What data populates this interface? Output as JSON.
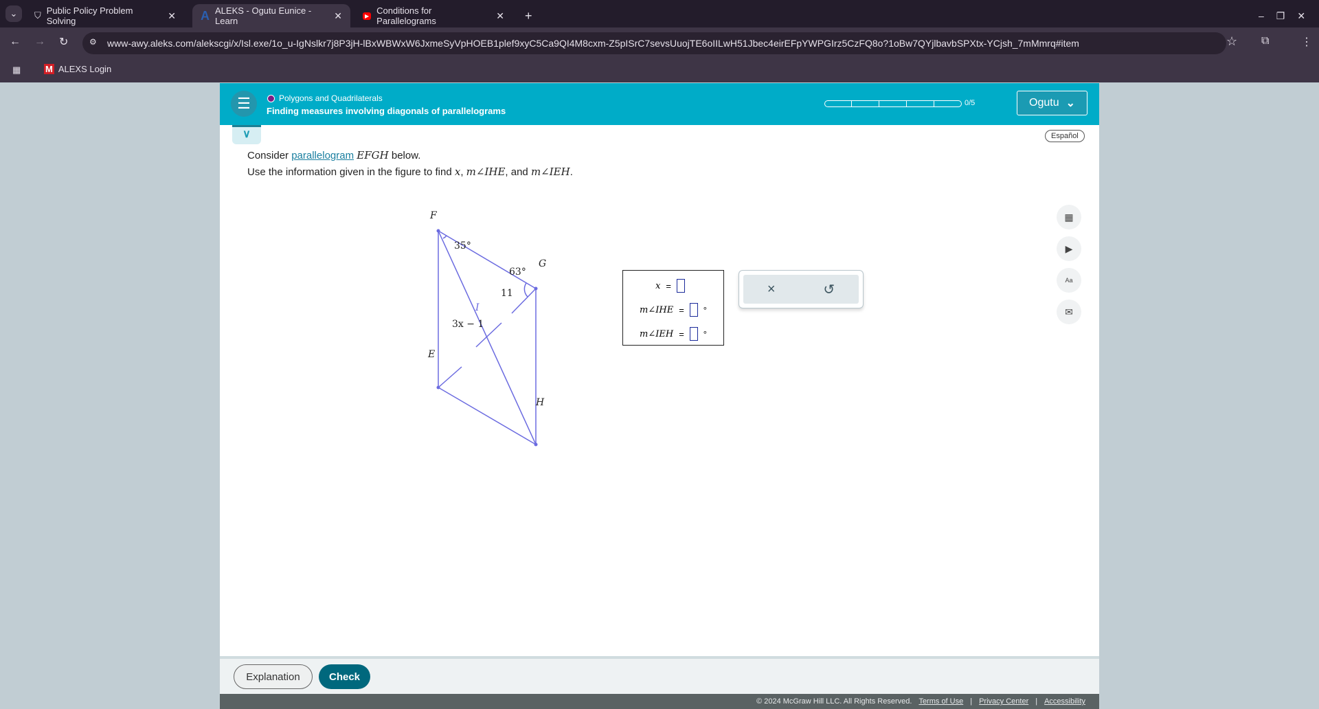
{
  "browser": {
    "tabs": [
      {
        "label": "Public Policy Problem Solving",
        "icon": "shield-icon"
      },
      {
        "label": "ALEKS - Ogutu Eunice - Learn",
        "icon": "aleks-icon",
        "active": true
      },
      {
        "label": "Conditions for Parallelograms",
        "icon": "youtube-icon"
      }
    ],
    "url": "www-awy.aleks.com/alekscgi/x/Isl.exe/1o_u-IgNslkr7j8P3jH-lBxWBWxW6JxmeSyVpHOEB1plef9xyC5Ca9QI4M8cxm-Z5pISrC7sevsUuojTE6oIILwH51Jbec4eirEFpYWPGIrz5CzFQ8o?1oBw7QYjlbavbSPXtx-YCjsh_7mMmrq#item",
    "bookmark": "ALEXS Login"
  },
  "header": {
    "topic": "Polygons and Quadrilaterals",
    "title": "Finding measures involving diagonals of parallelograms",
    "progress_text": "0/5",
    "progress": {
      "done": 0,
      "total": 5
    },
    "user": "Ogutu",
    "accent": "#00acc8"
  },
  "espanol": "Español",
  "question": {
    "line1_pre": "Consider ",
    "line1_link": "parallelogram",
    "line1_math": "EFGH",
    "line1_post": " below.",
    "line2_pre": "Use the information given in the figure to find ",
    "line2_x": "x",
    "line2_a1": "m∠IHE",
    "line2_and": ", and ",
    "line2_a2": "m∠IEH",
    "line2_end": "."
  },
  "figure": {
    "labels": {
      "F": "F",
      "G": "G",
      "E": "E",
      "H": "H",
      "I": "I"
    },
    "angle_F": "35°",
    "angle_G": "63°",
    "seg_IG": "11",
    "seg_EI": "3x − 1"
  },
  "answers": [
    {
      "label": "x",
      "unit": ""
    },
    {
      "label": "m∠IHE",
      "unit": "°"
    },
    {
      "label": "m∠IEH",
      "unit": "°"
    }
  ],
  "eq": "=",
  "tools": {
    "clear": "×",
    "undo": "↺"
  },
  "side_icons": [
    "calculator-icon",
    "video-icon",
    "dictionary-icon",
    "mail-icon"
  ],
  "footer": {
    "explanation": "Explanation",
    "check": "Check",
    "copyright": "© 2024 McGraw Hill LLC. All Rights Reserved.",
    "links": [
      "Terms of Use",
      "Privacy Center",
      "Accessibility"
    ]
  }
}
